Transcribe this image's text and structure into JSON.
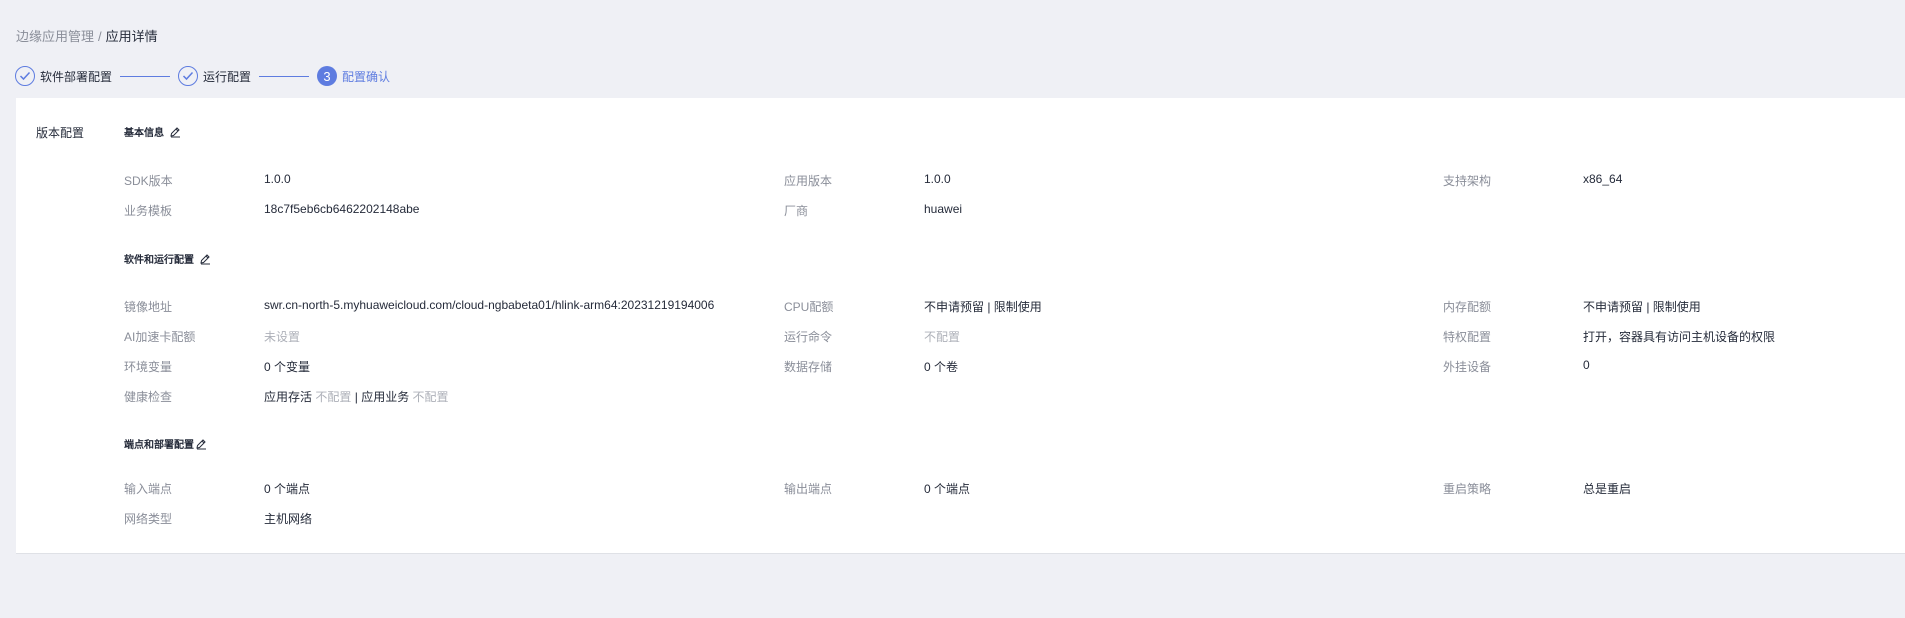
{
  "breadcrumb": {
    "parent": "边缘应用管理",
    "separator": "/",
    "current": "应用详情"
  },
  "steps": [
    {
      "label": "软件部署配置",
      "status": "done"
    },
    {
      "label": "运行配置",
      "status": "done"
    },
    {
      "number": "3",
      "label": "配置确认",
      "status": "active"
    }
  ],
  "colors": {
    "accent": "#5e7ce0",
    "background": "#eff0f5"
  },
  "version_config": {
    "label": "版本配置",
    "basic": {
      "title": "基本信息",
      "sdk": {
        "label": "SDK版本",
        "value": "1.0.0"
      },
      "app_version": {
        "label": "应用版本",
        "value": "1.0.0"
      },
      "arch": {
        "label": "支持架构",
        "value": "x86_64"
      },
      "template": {
        "label": "业务模板",
        "value": "18c7f5eb6cb6462202148abe"
      },
      "vendor": {
        "label": "厂商",
        "value": "huawei"
      }
    },
    "software": {
      "title": "软件和运行配置",
      "image": {
        "label": "镜像地址",
        "value": "swr.cn-north-5.myhuaweicloud.com/cloud-ngbabeta01/hlink-arm64:20231219194006"
      },
      "cpu": {
        "label": "CPU配额",
        "value": "不申请预留 | 限制使用"
      },
      "memory": {
        "label": "内存配额",
        "value": "不申请预留 | 限制使用"
      },
      "ai": {
        "label": "AI加速卡配额",
        "value": "未设置"
      },
      "command": {
        "label": "运行命令",
        "value": "不配置"
      },
      "privilege": {
        "label": "特权配置",
        "value": "打开，容器具有访问主机设备的权限"
      },
      "env": {
        "label": "环境变量",
        "value": "0 个变量"
      },
      "storage": {
        "label": "数据存储",
        "value": "0 个卷"
      },
      "devices": {
        "label": "外挂设备",
        "value": "0"
      },
      "health": {
        "label": "健康检查",
        "liveness_label": "应用存活",
        "liveness_value": "不配置",
        "separator": "|",
        "readiness_label": "应用业务",
        "readiness_value": "不配置"
      }
    },
    "endpoints": {
      "title": "端点和部署配置",
      "input": {
        "label": "输入端点",
        "value": "0 个端点"
      },
      "output": {
        "label": "输出端点",
        "value": "0 个端点"
      },
      "restart": {
        "label": "重启策略",
        "value": "总是重启"
      },
      "network": {
        "label": "网络类型",
        "value": "主机网络"
      }
    }
  }
}
